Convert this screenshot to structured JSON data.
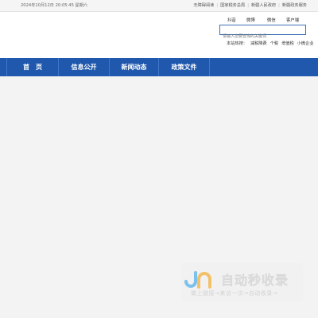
{
  "topbar": {
    "datetime": "2024年10月12日 20:05:45 星期六",
    "links": [
      "无障碍阅读",
      "国家税务总局",
      "新疆人民政府",
      "新疆政务服务"
    ]
  },
  "header": {
    "social": [
      "抖音",
      "微博",
      "微信",
      "客户端"
    ],
    "search": {
      "placeholder": "请输入您要查询的关键词",
      "value": ""
    },
    "hot": {
      "label": "本站热搜：",
      "keywords": [
        "减税降费",
        "个税",
        "增值税",
        "小微企业"
      ]
    }
  },
  "nav": {
    "items": [
      "首　页",
      "信息公开",
      "新闻动态",
      "政策文件"
    ]
  },
  "watermark": {
    "title": "自动秒收录",
    "subtitle": "做上链接→来访一次→自动收录→"
  }
}
